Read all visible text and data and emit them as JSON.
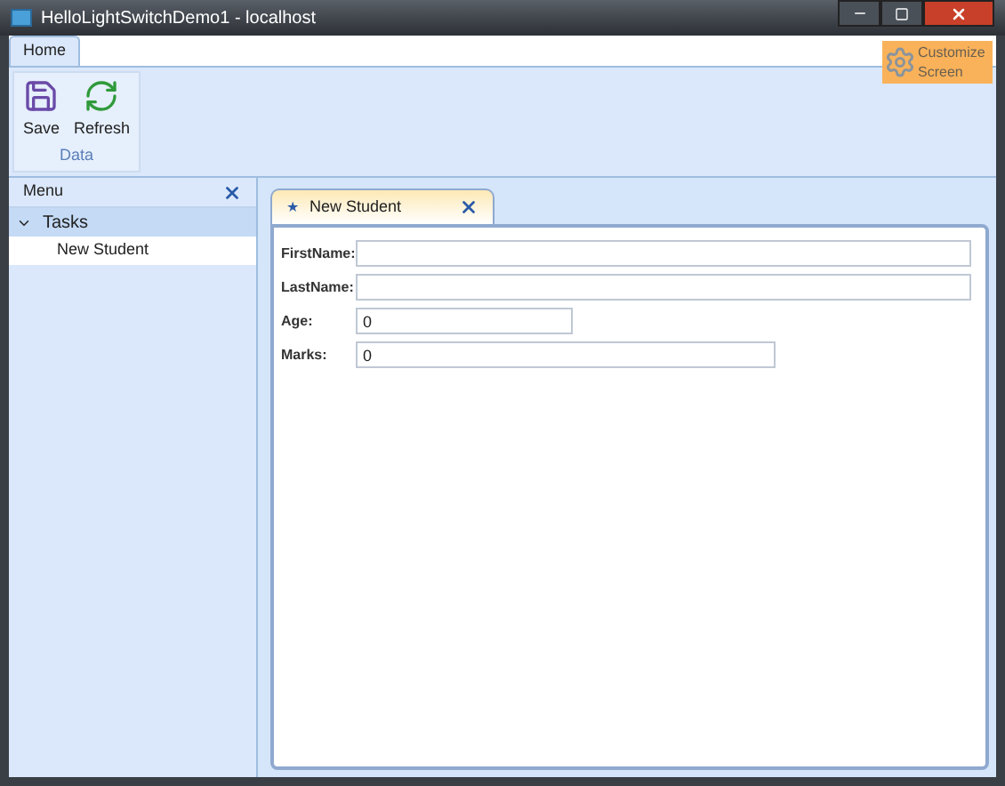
{
  "window": {
    "title": "HelloLightSwitchDemo1 - localhost"
  },
  "ribbon": {
    "tabs": [
      {
        "label": "Home",
        "selected": true
      }
    ],
    "groups": [
      {
        "label": "Data",
        "buttons": [
          {
            "kind": "save",
            "label": "Save"
          },
          {
            "kind": "refresh",
            "label": "Refresh"
          }
        ]
      }
    ],
    "customize": {
      "label": "Customize Screen"
    }
  },
  "menu": {
    "title": "Menu",
    "sections": [
      {
        "label": "Tasks",
        "expanded": true,
        "children": [
          {
            "label": "New Student",
            "selected": true
          }
        ]
      }
    ]
  },
  "document_tabs": [
    {
      "icon": "★",
      "label": "New Student",
      "selected": true
    }
  ],
  "form": {
    "fields": [
      {
        "label": "FirstName:",
        "kind": "long"
      },
      {
        "label": "LastName:",
        "kind": "long"
      },
      {
        "label": "Age:",
        "value": "0",
        "kind": "short"
      },
      {
        "label": "Marks:",
        "value": "0",
        "kind": "medium"
      }
    ]
  }
}
